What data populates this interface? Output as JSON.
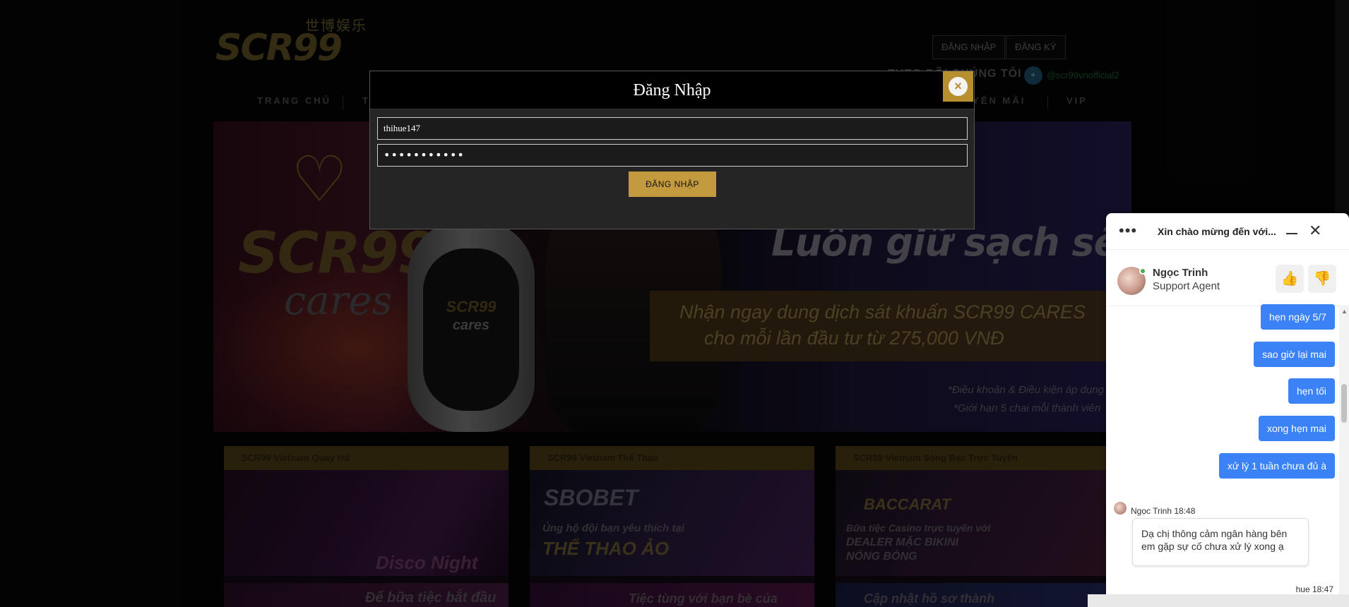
{
  "header": {
    "logo_cn": "世博娱乐",
    "logo_text": "SCR99",
    "login_label": "ĐĂNG NHẬP",
    "register_label": "ĐĂNG KÝ",
    "follow_label": "THEO DÕI CHÚNG TÔI :",
    "telegram_handle": "@scr99vnofficial2"
  },
  "nav": {
    "items": [
      "TRANG CHỦ",
      "T",
      "KHUYẾN MÃI",
      "VIP"
    ]
  },
  "banner": {
    "brand": "SCR99",
    "brand_sub": "cares",
    "bottle_brand": "SCR99",
    "bottle_sub": "cares",
    "headline": "Luôn giữ sạch sẽ",
    "promo_line1": "Nhận ngay dung dịch sát khuẩn SCR99 CARES",
    "promo_line2": "cho mỗi lần đầu tư từ 275,000 VNĐ",
    "terms1": "*Điều khoản & Điều kiện áp dụng",
    "terms2": "*Giới hạn 5 chai mỗi thành viên"
  },
  "cards": [
    {
      "title": "SCR99 Vietnam Quay Hũ",
      "caption": "Disco Night",
      "caption2": "Để bữa tiệc bắt đầu"
    },
    {
      "title": "SCR99 Vietnam Thể Thao",
      "caption": "SBOBET",
      "caption2": "Ủng hộ đội bạn yêu thích tại",
      "caption3": "THỂ THAO ẢO",
      "caption4": "Tiệc tùng với bạn bè của"
    },
    {
      "title": "SCR99 Vietnam Sòng Bạc Trực Tuyến",
      "caption": "BACCARAT",
      "caption2": "Bữa tiệc Casino trực tuyến với",
      "caption3": "DEALER MẶC BIKINI",
      "caption4": "NÓNG BỎNG",
      "caption5": "Cập nhật hồ sơ thành"
    }
  ],
  "modal": {
    "title": "Đăng Nhập",
    "username_value": "thihue147",
    "password_value": "•••••••••••",
    "submit_label": "ĐĂNG NHẬP",
    "close_icon": "×"
  },
  "chat": {
    "menu_icon": "•••",
    "title": "Xin chào mừng đến với...",
    "close_icon": "✕",
    "agent_name": "Ngọc Trinh",
    "agent_role": "Support Agent",
    "thumb_up_icon": "👍",
    "thumb_down_icon": "👎",
    "messages_out": [
      "hẹn ngày 5/7",
      "sao giờ lại mai",
      "hẹn tối",
      "xong hẹn mai",
      "xử lý 1 tuần chưa đủ à"
    ],
    "incoming_meta": "Ngọc Trinh 18:48",
    "incoming_text": "Dạ chị thông cảm ngân hàng bên em gặp sự cố chưa xử lý xong ạ",
    "last_time": "hue 18:47",
    "scroll_up": "▲",
    "scroll_down": "▼"
  },
  "colors": {
    "gold": "#c39a3e",
    "chat_blue": "#3b82f6"
  }
}
